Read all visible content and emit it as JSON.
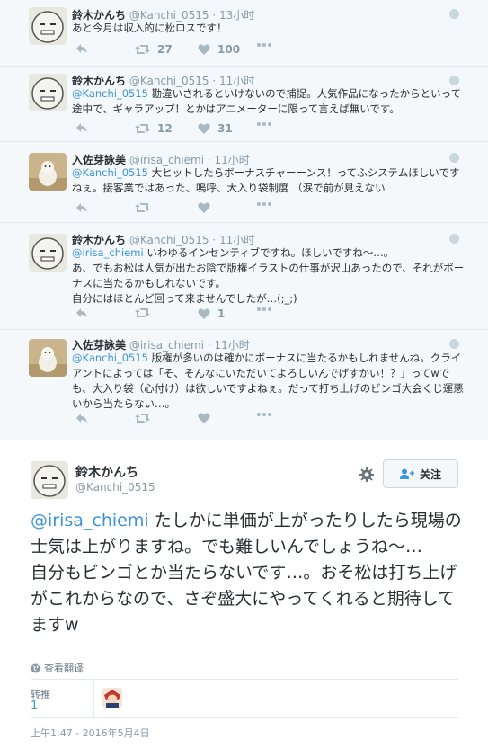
{
  "tweets": [
    {
      "name": "鈴木かんち",
      "handle": "@Kanchi_0515",
      "time": "13小时",
      "text_mention": "",
      "text": "あと今月は収入的に松ロスです！",
      "retweets": "27",
      "likes": "100"
    },
    {
      "name": "鈴木かんち",
      "handle": "@Kanchi_0515",
      "time": "11小时",
      "text_mention": "@Kanchi_0515",
      "text": " 勘違いされるといけないので捕捉。人気作品になったからといって途中で、ギャラアップ！とかはアニメーターに限って言えば無いです。",
      "retweets": "12",
      "likes": "31"
    },
    {
      "name": "入佐芽詠美",
      "handle": "@irisa_chiemi",
      "time": "11小时",
      "text_mention": "@Kanchi_0515",
      "text": " 大ヒットしたらボーナスチャーーンス！ってふシステムほしいですねぇ。接客業ではあった、嗚呼、大入り袋制度 （涙で前が見えない",
      "retweets": "",
      "likes": ""
    },
    {
      "name": "鈴木かんち",
      "handle": "@Kanchi_0515",
      "time": "11小时",
      "text_mention": "@irisa_chiemi",
      "text": " いわゆるインセンティブですね。ほしいですね～…。\nあ、でもお松は人気が出たお陰で版権イラストの仕事が沢山あったので、それがボーナスに当たるかもしれないです。\n自分にはほとんど回って来ませんでしたが…(;_;)",
      "retweets": "",
      "likes": "1"
    },
    {
      "name": "入佐芽詠美",
      "handle": "@irisa_chiemi",
      "time": "11小时",
      "text_mention": "@Kanchi_0515",
      "text": " 版権が多いのは確かにボーナスに当たるかもしれませんね。クライアントによっては「そ、そんなにいただいてよろしいんでげすかい！？」ってwでも、大入り袋（心付け）は欲しいですよねぇ。だって打ち上げのビンゴ大会くじ運悪いから当たらない…。",
      "retweets": "",
      "likes": ""
    }
  ],
  "main": {
    "name": "鈴木かんち",
    "handle": "@Kanchi_0515",
    "follow_label": "关注",
    "mention": "@irisa_chiemi",
    "text": " たしかに単価が上がったりしたら現場の士気は上がりますね。でも難しいんでしょうね～…\n自分もビンゴとか当たらないです…。おそ松は打ち上げがこれからなので、さぞ盛大にやってくれると期待してますw",
    "translate": "查看翻译",
    "retweet_label": "转推",
    "retweet_count": "1",
    "timestamp": "上午1:47 - 2016年5月4日"
  },
  "colors": {
    "link": "#3b94d9",
    "muted": "#8899a6",
    "text": "#292f33",
    "timeline_bg": "#f5f8fa"
  },
  "icons": [
    "reply-icon",
    "retweet-icon",
    "like-icon",
    "more-icon",
    "globe-icon",
    "gear-icon",
    "follow-user-icon"
  ]
}
